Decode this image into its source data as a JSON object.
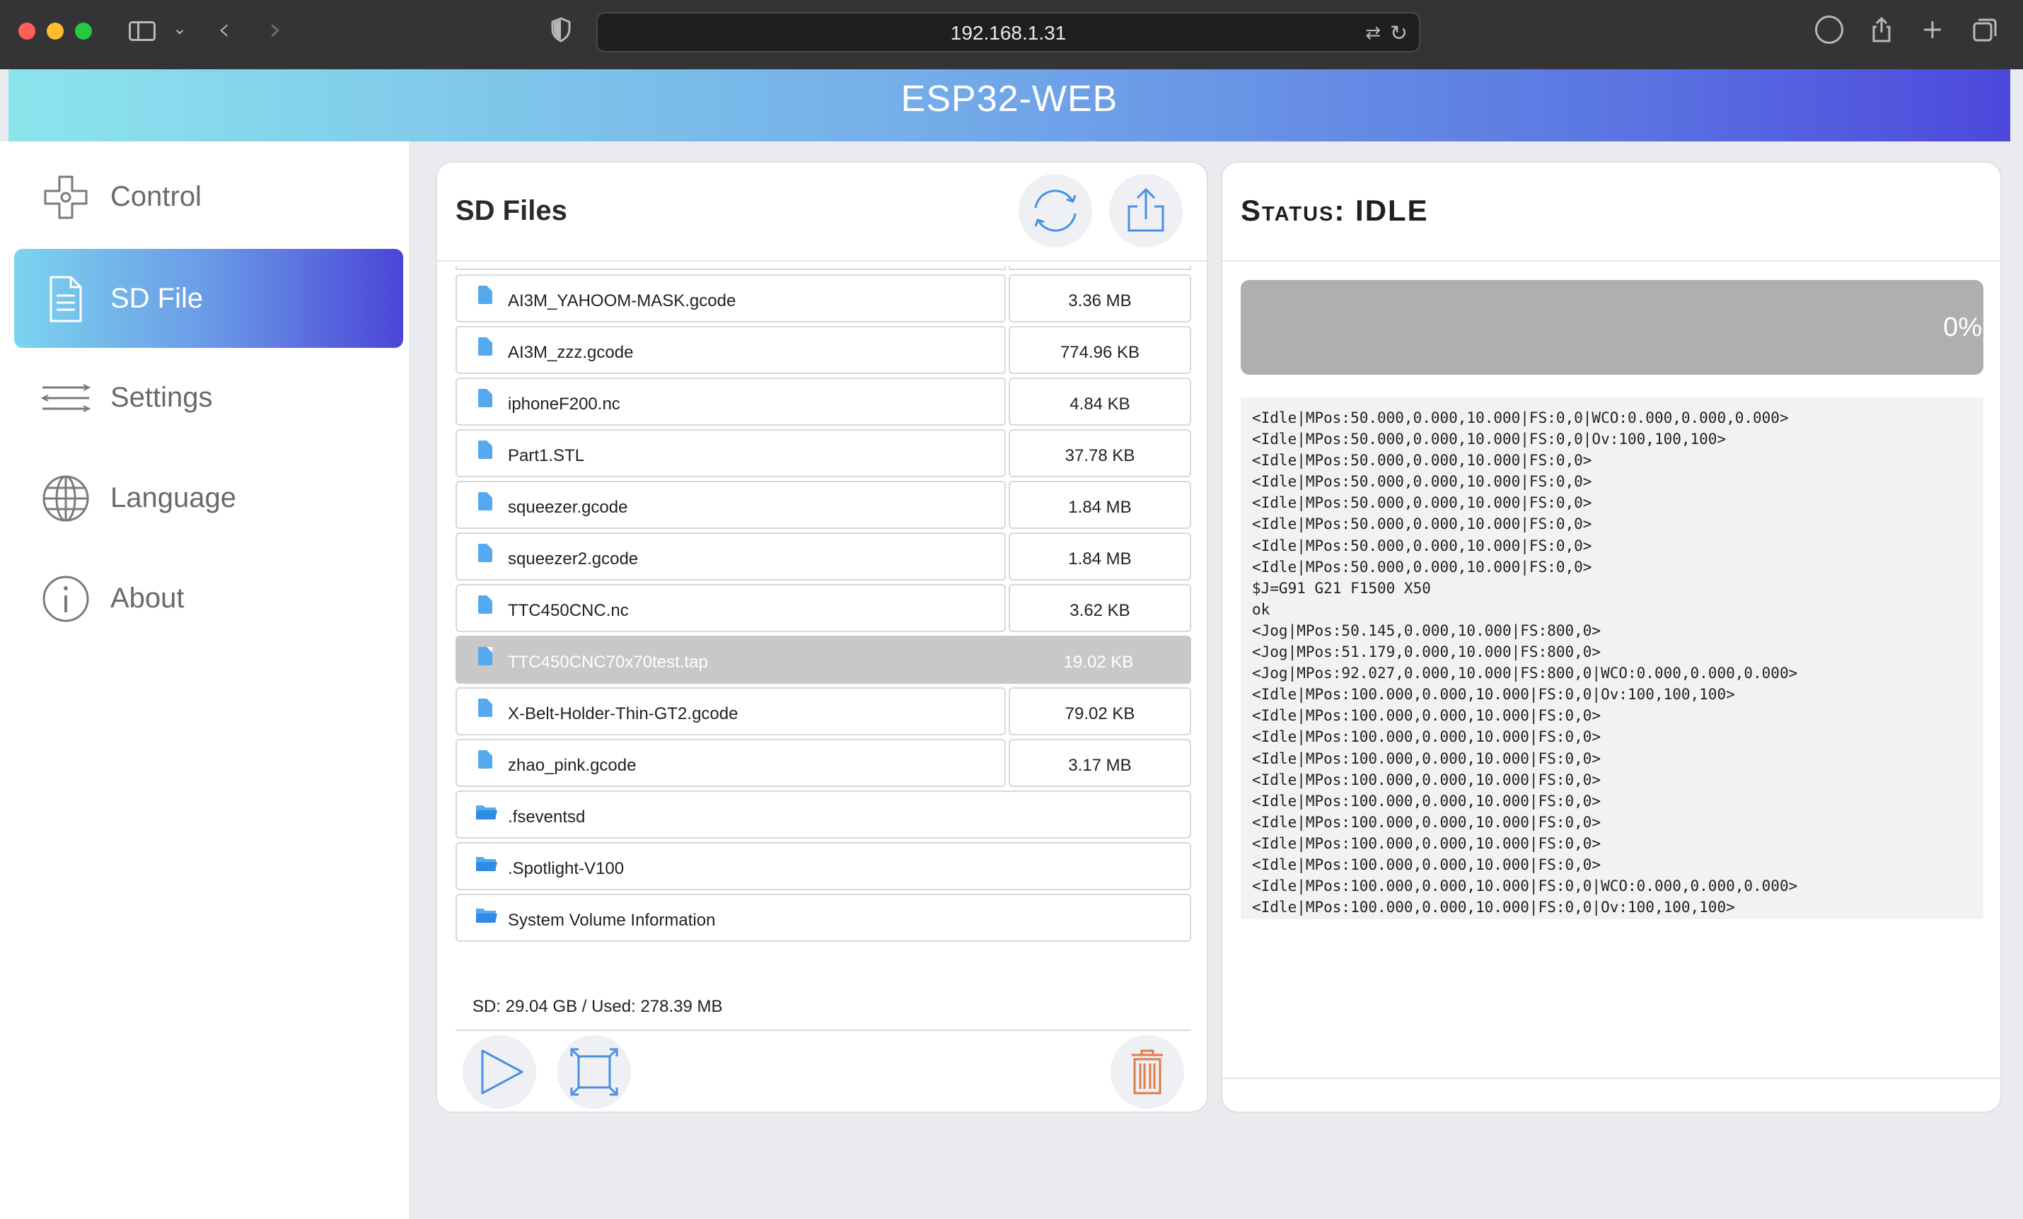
{
  "browser": {
    "url": "192.168.1.31"
  },
  "app": {
    "title": "ESP32-WEB"
  },
  "sidebar": {
    "items": [
      {
        "label": "Control",
        "icon": "dpad-icon"
      },
      {
        "label": "SD File",
        "icon": "document-icon",
        "active": true
      },
      {
        "label": "Settings",
        "icon": "sliders-icon"
      },
      {
        "label": "Language",
        "icon": "globe-icon"
      },
      {
        "label": "About",
        "icon": "info-icon"
      }
    ]
  },
  "files": {
    "title": "SD Files",
    "rows": [
      {
        "name": "AI3M_YAHOOM-MASK.gcode",
        "size": "3.36 MB",
        "type": "file"
      },
      {
        "name": "AI3M_zzz.gcode",
        "size": "774.96 KB",
        "type": "file"
      },
      {
        "name": "iphoneF200.nc",
        "size": "4.84 KB",
        "type": "file"
      },
      {
        "name": "Part1.STL",
        "size": "37.78 KB",
        "type": "file"
      },
      {
        "name": "squeezer.gcode",
        "size": "1.84 MB",
        "type": "file"
      },
      {
        "name": "squeezer2.gcode",
        "size": "1.84 MB",
        "type": "file"
      },
      {
        "name": "TTC450CNC.nc",
        "size": "3.62 KB",
        "type": "file"
      },
      {
        "name": "TTC450CNC70x70test.tap",
        "size": "19.02 KB",
        "type": "file",
        "selected": true
      },
      {
        "name": "X-Belt-Holder-Thin-GT2.gcode",
        "size": "79.02 KB",
        "type": "file"
      },
      {
        "name": "zhao_pink.gcode",
        "size": "3.17 MB",
        "type": "file"
      },
      {
        "name": ".fseventsd",
        "size": "",
        "type": "folder"
      },
      {
        "name": ".Spotlight-V100",
        "size": "",
        "type": "folder"
      },
      {
        "name": "System Volume Information",
        "size": "",
        "type": "folder"
      }
    ],
    "sd_info": "SD: 29.04 GB  /  Used: 278.39 MB"
  },
  "status": {
    "label": "Status:",
    "state": "IDLE",
    "progress_percent": 0,
    "progress_text": "0%",
    "console": [
      "<Idle|MPos:50.000,0.000,10.000|FS:0,0|WCO:0.000,0.000,0.000>",
      "<Idle|MPos:50.000,0.000,10.000|FS:0,0|Ov:100,100,100>",
      "<Idle|MPos:50.000,0.000,10.000|FS:0,0>",
      "<Idle|MPos:50.000,0.000,10.000|FS:0,0>",
      "<Idle|MPos:50.000,0.000,10.000|FS:0,0>",
      "<Idle|MPos:50.000,0.000,10.000|FS:0,0>",
      "<Idle|MPos:50.000,0.000,10.000|FS:0,0>",
      "<Idle|MPos:50.000,0.000,10.000|FS:0,0>",
      "$J=G91 G21 F1500 X50",
      "ok",
      "<Jog|MPos:50.145,0.000,10.000|FS:800,0>",
      "<Jog|MPos:51.179,0.000,10.000|FS:800,0>",
      "<Jog|MPos:92.027,0.000,10.000|FS:800,0|WCO:0.000,0.000,0.000>",
      "<Idle|MPos:100.000,0.000,10.000|FS:0,0|Ov:100,100,100>",
      "<Idle|MPos:100.000,0.000,10.000|FS:0,0>",
      "<Idle|MPos:100.000,0.000,10.000|FS:0,0>",
      "<Idle|MPos:100.000,0.000,10.000|FS:0,0>",
      "<Idle|MPos:100.000,0.000,10.000|FS:0,0>",
      "<Idle|MPos:100.000,0.000,10.000|FS:0,0>",
      "<Idle|MPos:100.000,0.000,10.000|FS:0,0>",
      "<Idle|MPos:100.000,0.000,10.000|FS:0,0>",
      "<Idle|MPos:100.000,0.000,10.000|FS:0,0>",
      "<Idle|MPos:100.000,0.000,10.000|FS:0,0|WCO:0.000,0.000,0.000>",
      "<Idle|MPos:100.000,0.000,10.000|FS:0,0|Ov:100,100,100>"
    ]
  },
  "colors": {
    "accent_start": "#7cd4ef",
    "accent_end": "#4b45d8",
    "file_icon": "#55a9ef",
    "trash": "#e07b4a"
  }
}
